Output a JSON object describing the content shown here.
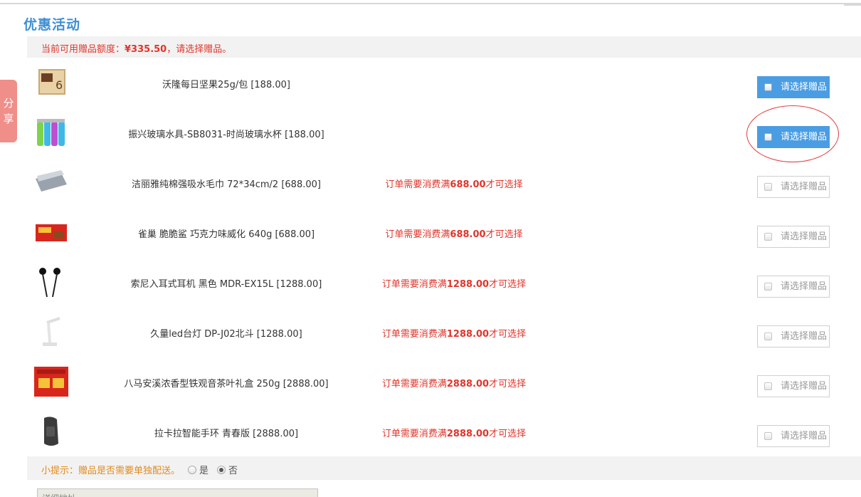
{
  "section_title": "优惠活动",
  "notice": {
    "prefix": "当前可用赠品额度：",
    "amount": "¥335.50",
    "suffix": "，请选择赠品。"
  },
  "share_tab": {
    "line1": "分",
    "line2": "享"
  },
  "gift_button_label": "请选择赠品",
  "gifts": [
    {
      "name": "沃隆每日坚果25g/包 [188.00]",
      "cond_prefix": "",
      "cond_amount": "",
      "cond_suffix": "",
      "selectable": true,
      "thumb_icon": "nut-pack-icon"
    },
    {
      "name": "振兴玻璃水具-SB8031-时尚玻璃水杯 [188.00]",
      "cond_prefix": "",
      "cond_amount": "",
      "cond_suffix": "",
      "selectable": true,
      "thumb_icon": "glass-bottles-icon"
    },
    {
      "name": "洁丽雅纯棉强吸水毛巾 72*34cm/2 [688.00]",
      "cond_prefix": "订单需要消费满",
      "cond_amount": "688.00",
      "cond_suffix": "才可选择",
      "selectable": false,
      "thumb_icon": "towel-icon"
    },
    {
      "name": "雀巢 脆脆鲨 巧克力味威化 640g [688.00]",
      "cond_prefix": "订单需要消费满",
      "cond_amount": "688.00",
      "cond_suffix": "才可选择",
      "selectable": false,
      "thumb_icon": "wafer-box-icon"
    },
    {
      "name": "索尼入耳式耳机 黑色 MDR-EX15L [1288.00]",
      "cond_prefix": "订单需要消费满",
      "cond_amount": "1288.00",
      "cond_suffix": "才可选择",
      "selectable": false,
      "thumb_icon": "earphones-icon"
    },
    {
      "name": "久量led台灯 DP-J02北斗 [1288.00]",
      "cond_prefix": "订单需要消费满",
      "cond_amount": "1288.00",
      "cond_suffix": "才可选择",
      "selectable": false,
      "thumb_icon": "desk-lamp-icon"
    },
    {
      "name": "八马安溪浓香型铁观音茶叶礼盒 250g [2888.00]",
      "cond_prefix": "订单需要消费满",
      "cond_amount": "2888.00",
      "cond_suffix": "才可选择",
      "selectable": false,
      "thumb_icon": "tea-giftbox-icon"
    },
    {
      "name": "拉卡拉智能手环 青春版 [2888.00]",
      "cond_prefix": "订单需要消费满",
      "cond_amount": "2888.00",
      "cond_suffix": "才可选择",
      "selectable": false,
      "thumb_icon": "smart-band-icon"
    }
  ],
  "hint": {
    "text": "小提示：赠品是否需要单独配送。",
    "options": [
      {
        "label": "是",
        "checked": false
      },
      {
        "label": "否",
        "checked": true
      }
    ]
  },
  "address_placeholder": "详细地址",
  "colors": {
    "accent_blue": "#4a9de3",
    "title_blue": "#3f8fd6",
    "alert_red": "#e0352b",
    "hint_orange": "#e28a1e",
    "annotation_red": "#e03a3a"
  }
}
